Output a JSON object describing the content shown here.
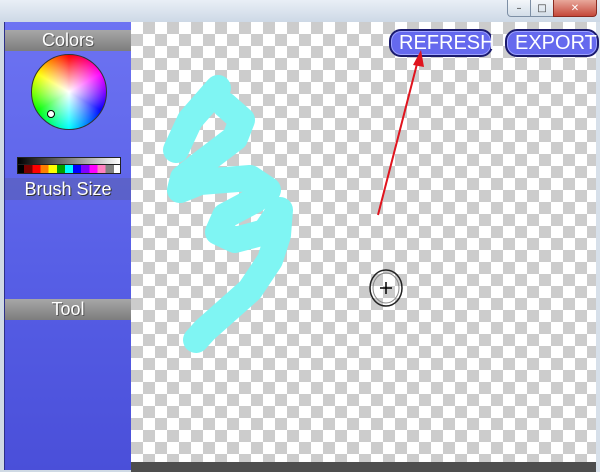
{
  "window": {
    "minimize_label": "–",
    "maximize_label": "□",
    "close_label": "✕"
  },
  "sidebar": {
    "colors_header": "Colors",
    "brush_size_label": "Brush Size",
    "tool_header": "Tool"
  },
  "toolbar": {
    "refresh_label": "REFRESH",
    "export_label": "EXPORT"
  },
  "canvas": {
    "stroke_color": "#7ff5f3",
    "background": "transparent-checkerboard"
  },
  "annotation": {
    "arrow_color": "#e0141e"
  },
  "cursor": {
    "icon": "crosshair-brush-cursor-icon"
  },
  "colors": {
    "sidebar_blue": "#575fe6",
    "button_blue": "#6569ee"
  }
}
